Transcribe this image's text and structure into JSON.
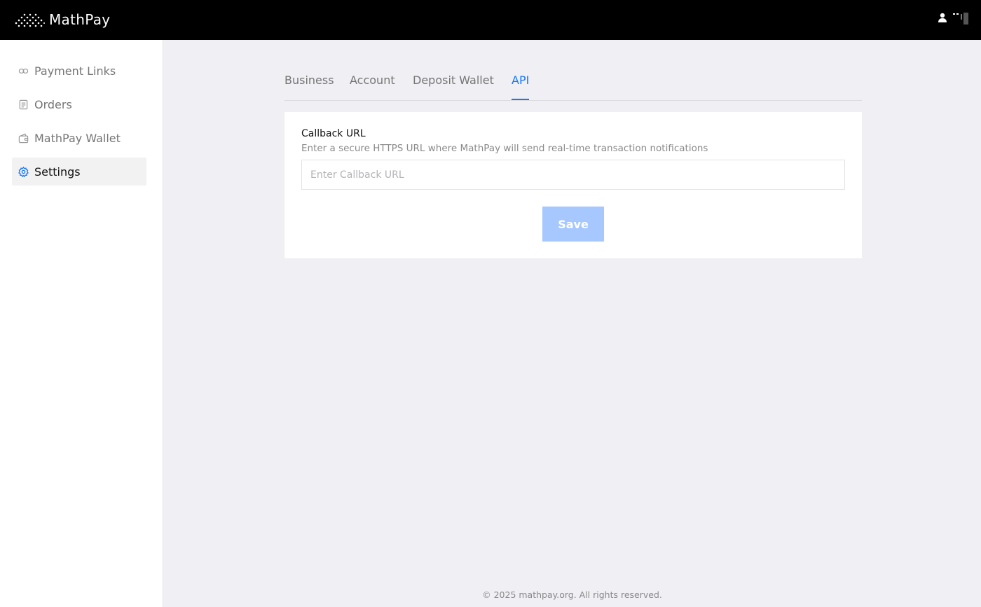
{
  "header": {
    "brand_name": "MathPay",
    "logo_icon": "dot-pattern-logo",
    "user_icon": "user-icon",
    "user_name_icon": "masked-name-icon"
  },
  "sidebar": {
    "items": [
      {
        "label": "Payment Links",
        "icon": "link-icon",
        "active": false
      },
      {
        "label": "Orders",
        "icon": "document-icon",
        "active": false
      },
      {
        "label": "MathPay Wallet",
        "icon": "wallet-icon",
        "active": false
      },
      {
        "label": "Settings",
        "icon": "gear-icon",
        "active": true
      }
    ]
  },
  "tabs": [
    {
      "label": "Business",
      "active": false
    },
    {
      "label": "Account",
      "active": false
    },
    {
      "label": "Deposit Wallet",
      "active": false
    },
    {
      "label": "API",
      "active": true
    }
  ],
  "api_form": {
    "label": "Callback URL",
    "description": "Enter a secure HTTPS URL where MathPay will send real-time transaction notifications",
    "value": "",
    "placeholder": "Enter Callback URL",
    "save_label": "Save",
    "save_disabled": true
  },
  "footer": {
    "text": "© 2025 mathpay.org. All rights reserved."
  },
  "colors": {
    "accent": "#1677ff",
    "save_disabled_bg": "#a6c8ff",
    "header_bg": "#000000",
    "page_bg": "#efeff4"
  }
}
